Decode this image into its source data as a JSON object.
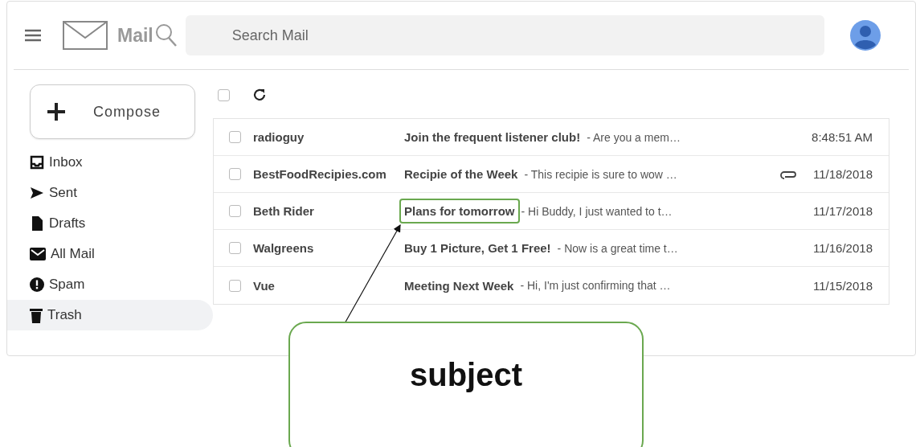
{
  "header": {
    "app_name": "Mail",
    "search": {
      "placeholder": "Search Mail"
    }
  },
  "compose": {
    "label": "Compose"
  },
  "sidebar": {
    "items": [
      {
        "kind": "inbox",
        "label": "Inbox",
        "selected": false
      },
      {
        "kind": "sent",
        "label": "Sent",
        "selected": false
      },
      {
        "kind": "drafts",
        "label": "Drafts",
        "selected": false
      },
      {
        "kind": "allmail",
        "label": "All Mail",
        "selected": false
      },
      {
        "kind": "spam",
        "label": "Spam",
        "selected": false
      },
      {
        "kind": "trash",
        "label": "Trash",
        "selected": true
      }
    ]
  },
  "toolbar": {
    "select_all": {
      "checked": false
    }
  },
  "emails": [
    {
      "sender": "radioguy",
      "subject": "Join the frequent listener club!",
      "snippet": "- Are you a mem…",
      "date": "8:48:51 AM",
      "attachment": false,
      "highlighted": false,
      "checked": false
    },
    {
      "sender": "BestFoodRecipies.com",
      "subject": "Recipie of the Week",
      "snippet": "- This recipie is sure to wow …",
      "date": "11/18/2018",
      "attachment": true,
      "highlighted": false,
      "checked": false
    },
    {
      "sender": "Beth Rider",
      "subject": "Plans for tomorrow",
      "snippet": "- Hi Buddy, I just wanted to t…",
      "date": "11/17/2018",
      "attachment": false,
      "highlighted": true,
      "checked": false
    },
    {
      "sender": "Walgreens",
      "subject": "Buy 1 Picture, Get 1 Free!",
      "snippet": "- Now is a great time t…",
      "date": "11/16/2018",
      "attachment": false,
      "highlighted": false,
      "checked": false
    },
    {
      "sender": "Vue",
      "subject": "Meeting Next Week",
      "snippet": "- Hi, I'm just confirming that …",
      "date": "11/15/2018",
      "attachment": false,
      "highlighted": false,
      "checked": false
    }
  ],
  "annotation": {
    "label": "subject"
  }
}
